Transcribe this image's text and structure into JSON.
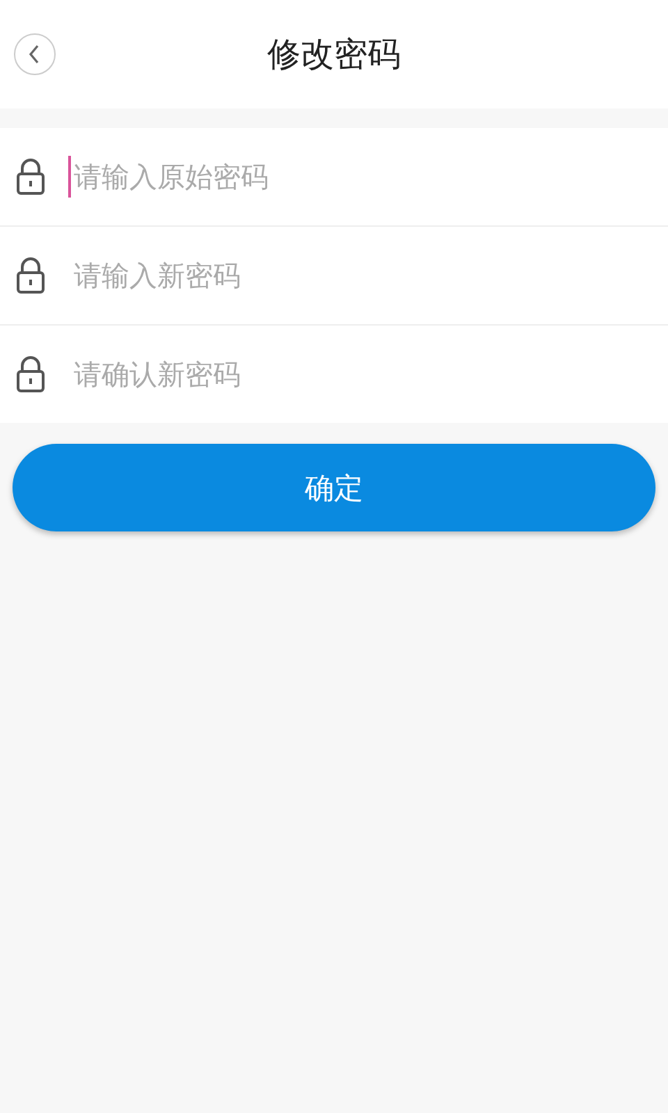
{
  "header": {
    "title": "修改密码"
  },
  "fields": [
    {
      "placeholder": "请输入原始密码",
      "focused": true
    },
    {
      "placeholder": "请输入新密码",
      "focused": false
    },
    {
      "placeholder": "请确认新密码",
      "focused": false
    }
  ],
  "submit_button": {
    "label": "确定"
  }
}
